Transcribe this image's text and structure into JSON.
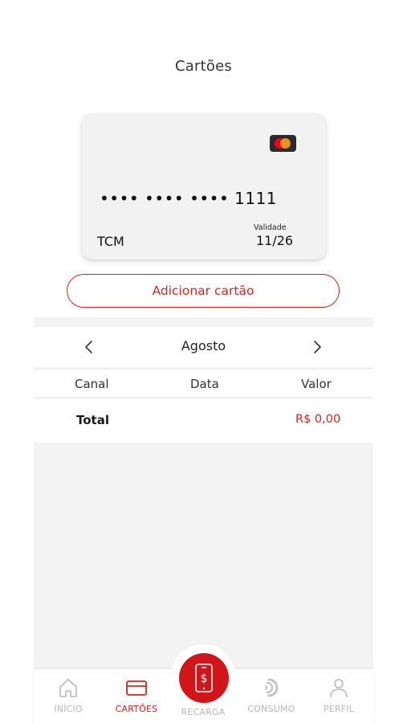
{
  "header": {
    "title": "Cartões"
  },
  "card": {
    "brand_icon": "mastercard-logo",
    "number": "•••• •••• •••• 1111",
    "holder": "TCM",
    "validity_label": "Validade",
    "validity_value": "11/26"
  },
  "actions": {
    "add_card_label": "Adicionar cartão"
  },
  "statement": {
    "month": "Agosto",
    "prev_icon": "chevron-left-icon",
    "next_icon": "chevron-right-icon",
    "columns": [
      "Canal",
      "Data",
      "Valor"
    ],
    "total_label": "Total",
    "total_value": "R$ 0,00"
  },
  "bottom_nav": {
    "items": [
      {
        "label": "INÍCIO",
        "icon": "home-icon",
        "active": false
      },
      {
        "label": "CARTÕES",
        "icon": "card-icon",
        "active": true
      },
      {
        "label": "RECARGA",
        "icon": "phone-dollar-icon",
        "active": false
      },
      {
        "label": "CONSUMO",
        "icon": "consumption-icon",
        "active": false
      },
      {
        "label": "PERFIL",
        "icon": "user-icon",
        "active": false
      }
    ]
  },
  "colors": {
    "accent": "#d0281f",
    "recarga_button": "#d0161a",
    "panel_bg": "#f3f3f3",
    "card_bg": "#f2f2f2",
    "inactive_nav": "#b8b8b8"
  }
}
